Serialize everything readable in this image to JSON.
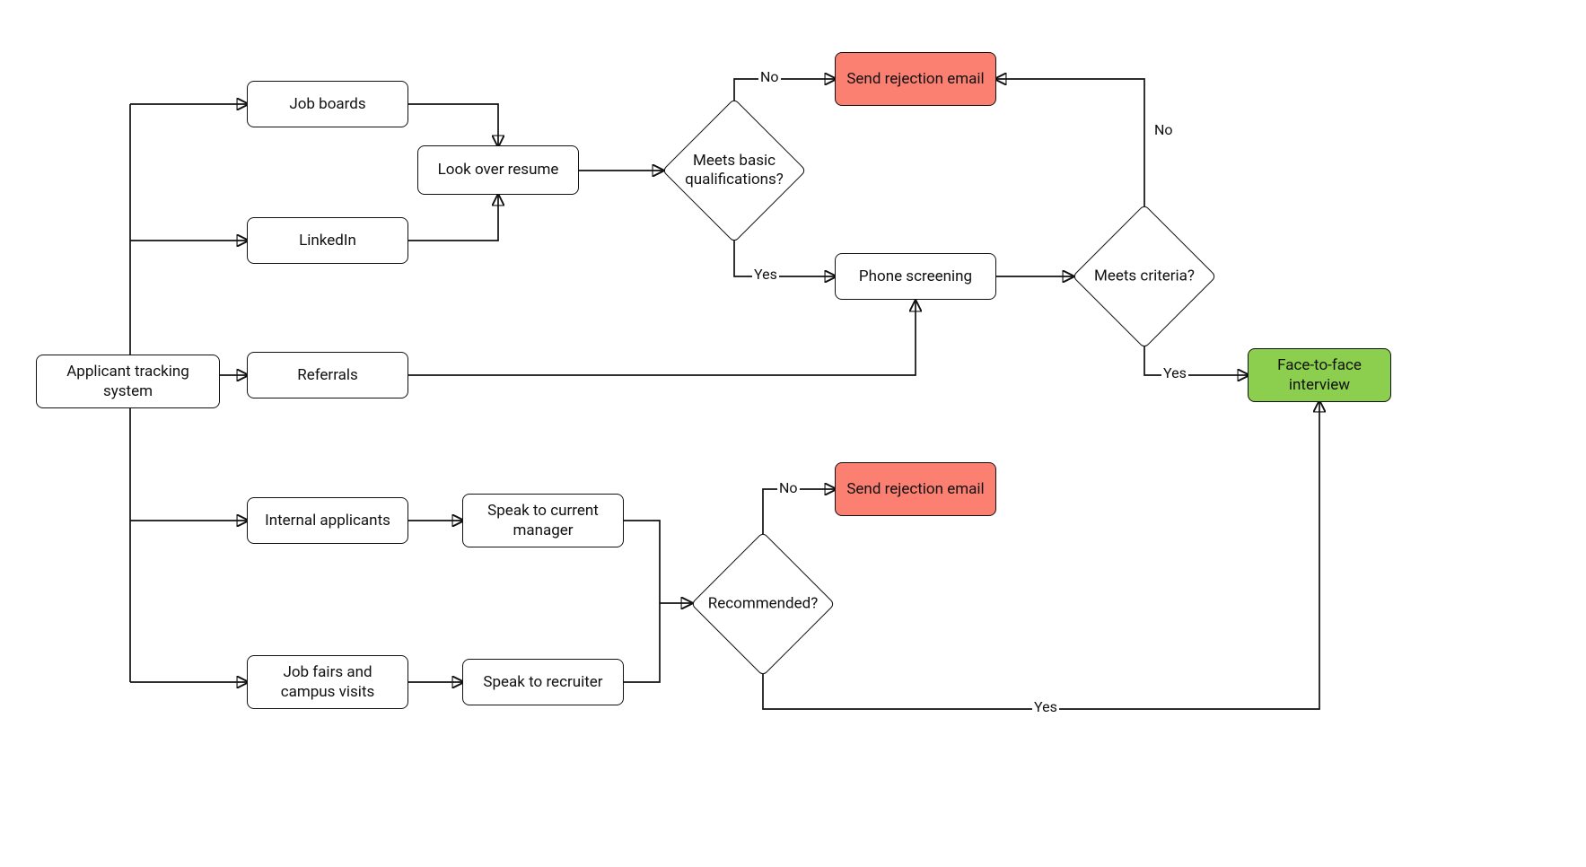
{
  "nodes": {
    "ats": "Applicant tracking system",
    "job_boards": "Job boards",
    "linkedin": "LinkedIn",
    "referrals": "Referrals",
    "internal": "Internal applicants",
    "jobfairs": "Job fairs and campus visits",
    "resume": "Look over resume",
    "curmgr": "Speak to current manager",
    "recruiter": "Speak to recruiter",
    "quals": "Meets basic qualifications?",
    "phone": "Phone screening",
    "criteria": "Meets criteria?",
    "recommended": "Recommended?",
    "reject1": "Send rejection email",
    "reject2": "Send rejection email",
    "interview": "Face-to-face interview"
  },
  "labels": {
    "no": "No",
    "yes": "Yes"
  },
  "colors": {
    "reject": "#fb8072",
    "interview": "#8cce4d"
  }
}
